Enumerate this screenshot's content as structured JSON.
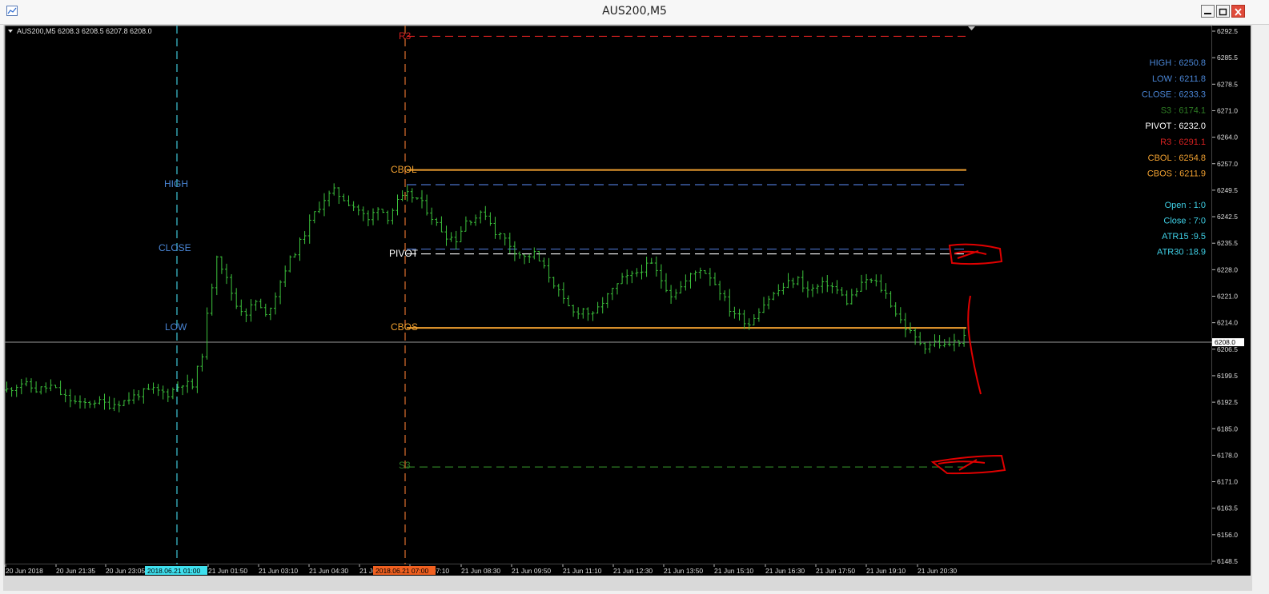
{
  "window": {
    "title": "AUS200,M5"
  },
  "symbol_line": "AUS200,M5  6208.3 6208.5 6207.8 6208.0",
  "info_panel": {
    "hlc": [
      {
        "text": "HIGH : 6250.8",
        "color": "#4a86d6"
      },
      {
        "text": "LOW : 6211.8",
        "color": "#4a86d6"
      },
      {
        "text": "CLOSE : 6233.3",
        "color": "#4a86d6"
      }
    ],
    "levels": [
      {
        "text": "S3 : 6174.1",
        "color": "#2e7d24"
      },
      {
        "text": "PIVOT : 6232.0",
        "color": "#ffffff"
      },
      {
        "text": "R3 : 6291.1",
        "color": "#d62020"
      },
      {
        "text": "CBOL : 6254.8",
        "color": "#f0a030"
      },
      {
        "text": "CBOS : 6211.9",
        "color": "#f0a030"
      }
    ],
    "stats": [
      {
        "text": "Open : 1:0",
        "color": "#3fd0e6"
      },
      {
        "text": "Close : 7:0",
        "color": "#3fd0e6"
      },
      {
        "text": "ATR15 :9.5",
        "color": "#3fd0e6"
      },
      {
        "text": "ATR30 :18.9",
        "color": "#3fd0e6"
      }
    ]
  },
  "chart_labels": {
    "prev_day": [
      "HIGH",
      "CLOSE",
      "LOW"
    ],
    "levels": [
      "R3",
      "CBOL",
      "PIVOT",
      "CBOS",
      "S3"
    ]
  },
  "current_price_label": "6208.0",
  "vline_labels": [
    "2018.06.21 01:00",
    "2018.06.21 07:00"
  ],
  "chart_data": {
    "type": "bar",
    "symbol": "AUS200",
    "timeframe": "M5",
    "ylim": [
      6148.5,
      6292.5
    ],
    "y_ticks": [
      "6292.5",
      "6285.5",
      "6278.5",
      "6271.0",
      "6264.0",
      "6257.0",
      "6249.5",
      "6242.5",
      "6235.5",
      "6228.0",
      "6221.0",
      "6214.0",
      "6206.5",
      "6199.5",
      "6192.5",
      "6185.0",
      "6178.0",
      "6171.0",
      "6163.5",
      "6156.0",
      "6148.5"
    ],
    "x_ticks": [
      "20 Jun 2018",
      "20 Jun 21:35",
      "20 Jun 23:05",
      "21 Jun 01:50",
      "21 Jun 03:10",
      "21 Jun 04:30",
      "21 Jun 05:50",
      "21 Jun 07:10",
      "21 Jun 08:30",
      "21 Jun 09:50",
      "21 Jun 11:10",
      "21 Jun 12:30",
      "21 Jun 13:50",
      "21 Jun 15:10",
      "21 Jun 16:30",
      "21 Jun 17:50",
      "21 Jun 19:10",
      "21 Jun 20:30"
    ],
    "levels": [
      {
        "name": "R3",
        "value": 6291.1,
        "color": "#d62020"
      },
      {
        "name": "CBOL",
        "value": 6254.8,
        "color": "#f0a030"
      },
      {
        "name": "HIGH",
        "value": 6250.8,
        "color": "#4a86d6"
      },
      {
        "name": "CLOSE",
        "value": 6233.3,
        "color": "#4a86d6"
      },
      {
        "name": "PIVOT",
        "value": 6232.0,
        "color": "#ffffff"
      },
      {
        "name": "CBOS",
        "value": 6211.9,
        "color": "#f0a030"
      },
      {
        "name": "LOW",
        "value": 6211.8,
        "color": "#4a86d6"
      },
      {
        "name": "S3",
        "value": 6174.1,
        "color": "#2e7d24"
      }
    ],
    "current_price": 6208.0,
    "close_path": [
      [
        0,
        6195
      ],
      [
        3,
        6197
      ],
      [
        6,
        6195
      ],
      [
        9,
        6196
      ],
      [
        12,
        6193
      ],
      [
        15,
        6191
      ],
      [
        18,
        6192
      ],
      [
        21,
        6191
      ],
      [
        24,
        6192
      ],
      [
        27,
        6194
      ],
      [
        30,
        6195
      ],
      [
        33,
        6194
      ],
      [
        36,
        6197
      ],
      [
        38,
        6196
      ],
      [
        40,
        6205
      ],
      [
        41,
        6215
      ],
      [
        43,
        6232
      ],
      [
        45,
        6225
      ],
      [
        47,
        6218
      ],
      [
        49,
        6216
      ],
      [
        51,
        6219
      ],
      [
        53,
        6215
      ],
      [
        55,
        6221
      ],
      [
        57,
        6228
      ],
      [
        60,
        6235
      ],
      [
        63,
        6243
      ],
      [
        65,
        6247
      ],
      [
        67,
        6249
      ],
      [
        69,
        6247
      ],
      [
        72,
        6244
      ],
      [
        74,
        6241
      ],
      [
        76,
        6245
      ],
      [
        78,
        6242
      ],
      [
        80,
        6246
      ],
      [
        82,
        6248
      ],
      [
        84,
        6247
      ],
      [
        86,
        6244
      ],
      [
        88,
        6240
      ],
      [
        90,
        6237
      ],
      [
        92,
        6236
      ],
      [
        94,
        6241
      ],
      [
        96,
        6242
      ],
      [
        98,
        6243
      ],
      [
        100,
        6238
      ],
      [
        102,
        6236
      ],
      [
        104,
        6233
      ],
      [
        106,
        6231
      ],
      [
        108,
        6232
      ],
      [
        110,
        6228
      ],
      [
        112,
        6224
      ],
      [
        114,
        6219
      ],
      [
        116,
        6216
      ],
      [
        118,
        6217
      ],
      [
        120,
        6215
      ],
      [
        122,
        6219
      ],
      [
        124,
        6222
      ],
      [
        126,
        6225
      ],
      [
        128,
        6226
      ],
      [
        130,
        6228
      ],
      [
        132,
        6229
      ],
      [
        134,
        6225
      ],
      [
        136,
        6221
      ],
      [
        138,
        6223
      ],
      [
        140,
        6226
      ],
      [
        142,
        6228
      ],
      [
        144,
        6226
      ],
      [
        146,
        6222
      ],
      [
        148,
        6217
      ],
      [
        150,
        6215
      ],
      [
        152,
        6213
      ],
      [
        154,
        6217
      ],
      [
        156,
        6220
      ],
      [
        158,
        6222
      ],
      [
        160,
        6224
      ],
      [
        162,
        6225
      ],
      [
        164,
        6222
      ],
      [
        166,
        6223
      ],
      [
        168,
        6224
      ],
      [
        170,
        6222
      ],
      [
        172,
        6219
      ],
      [
        174,
        6222
      ],
      [
        176,
        6225
      ],
      [
        178,
        6224
      ],
      [
        180,
        6221
      ],
      [
        182,
        6216
      ],
      [
        184,
        6212
      ],
      [
        186,
        6209
      ],
      [
        188,
        6207
      ],
      [
        190,
        6208
      ],
      [
        192,
        6207
      ],
      [
        194,
        6208
      ],
      [
        196,
        6209
      ]
    ]
  },
  "annotations": {
    "color": "#e00000",
    "note": ""
  }
}
